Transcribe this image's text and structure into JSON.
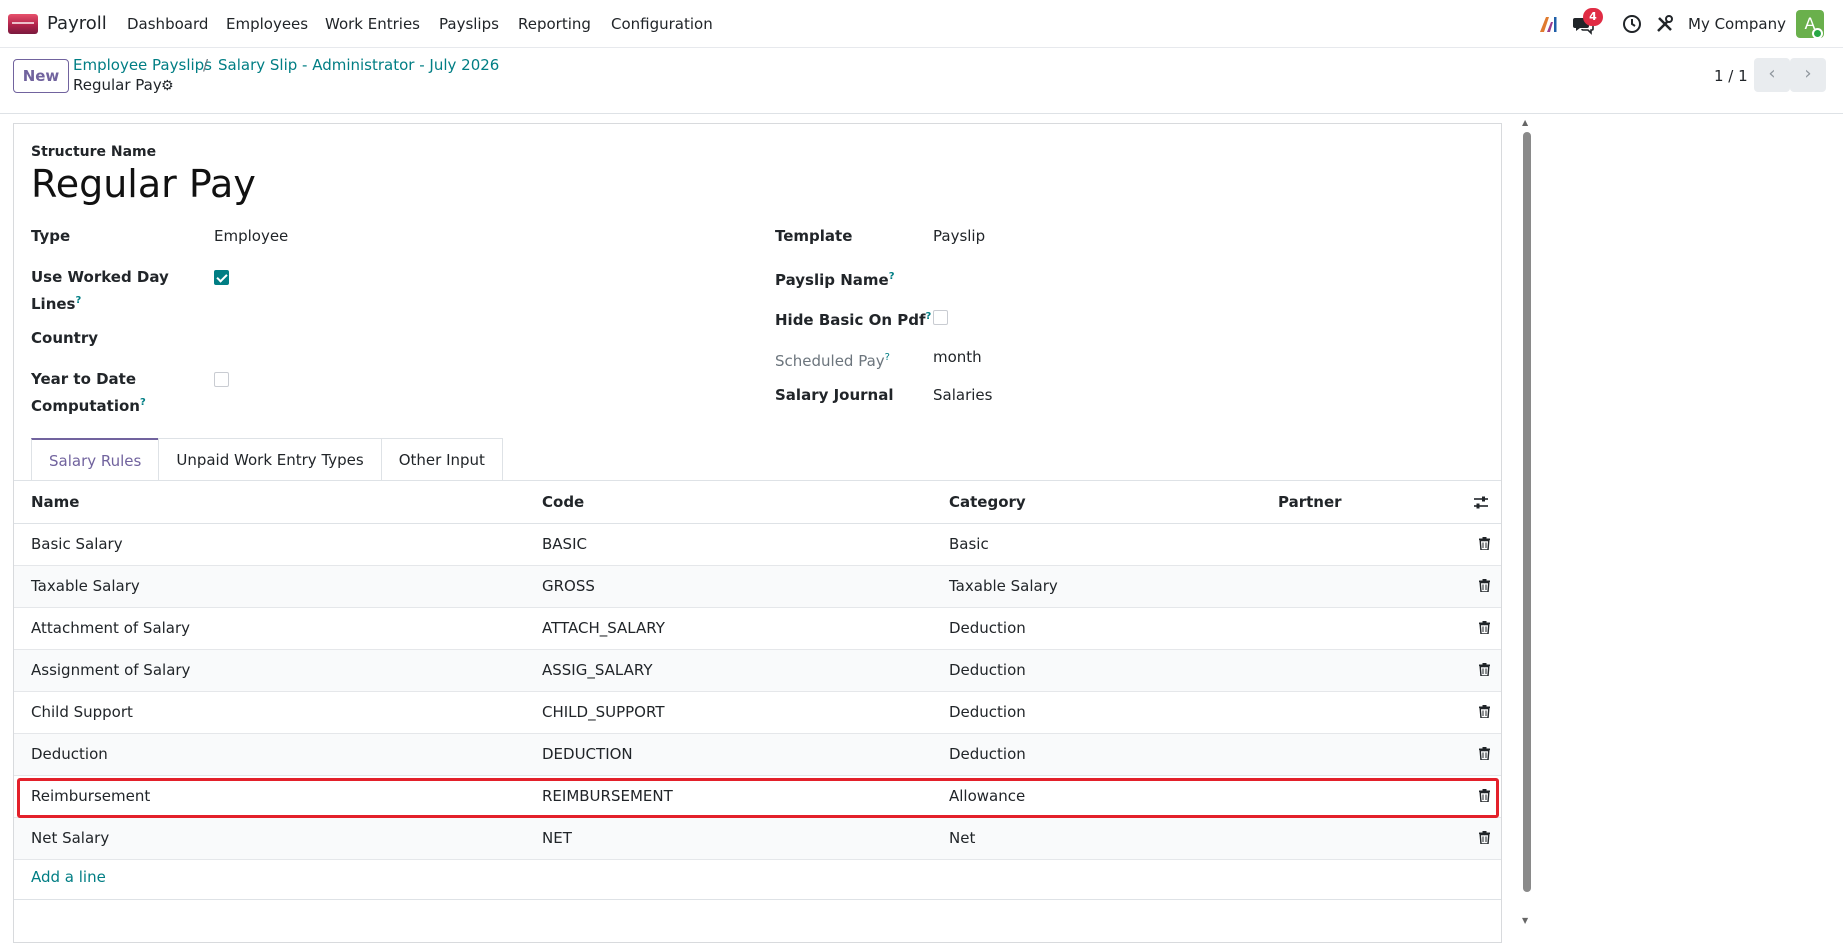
{
  "navbar": {
    "app_name": "Payroll",
    "menu": [
      "Dashboard",
      "Employees",
      "Work Entries",
      "Payslips",
      "Reporting",
      "Configuration"
    ],
    "messages_count": "4",
    "company": "My Company",
    "avatar_letter": "A"
  },
  "control": {
    "new_label": "New",
    "breadcrumbs": [
      "Employee Payslips",
      "Salary Slip - Administrator - July 2026"
    ],
    "separator": "/",
    "record_title": "Regular Pay",
    "pager": "1 / 1"
  },
  "form": {
    "structure_name_label": "Structure Name",
    "structure_name": "Regular Pay",
    "type_label": "Type",
    "type_value": "Employee",
    "worked_day_label_1": "Use Worked Day",
    "worked_day_label_2": "Lines",
    "worked_day_checked": true,
    "country_label": "Country",
    "ytd_label_1": "Year to Date",
    "ytd_label_2": "Computation",
    "ytd_checked": false,
    "template_label": "Template",
    "template_value": "Payslip",
    "payslip_name_label": "Payslip Name",
    "hide_basic_label": "Hide Basic On Pdf",
    "hide_basic_checked": false,
    "scheduled_pay_label": "Scheduled Pay",
    "scheduled_pay_value": "month",
    "salary_journal_label": "Salary Journal",
    "salary_journal_value": "Salaries",
    "help_mark": "?"
  },
  "tabs": [
    "Salary Rules",
    "Unpaid Work Entry Types",
    "Other Input"
  ],
  "table": {
    "headers": [
      "Name",
      "Code",
      "Category",
      "Partner"
    ],
    "rows": [
      {
        "name": "Basic Salary",
        "code": "BASIC",
        "category": "Basic"
      },
      {
        "name": "Taxable Salary",
        "code": "GROSS",
        "category": "Taxable Salary"
      },
      {
        "name": "Attachment of Salary",
        "code": "ATTACH_SALARY",
        "category": "Deduction"
      },
      {
        "name": "Assignment of Salary",
        "code": "ASSIG_SALARY",
        "category": "Deduction"
      },
      {
        "name": "Child Support",
        "code": "CHILD_SUPPORT",
        "category": "Deduction"
      },
      {
        "name": "Deduction",
        "code": "DEDUCTION",
        "category": "Deduction"
      },
      {
        "name": "Reimbursement",
        "code": "REIMBURSEMENT",
        "category": "Allowance"
      },
      {
        "name": "Net Salary",
        "code": "NET",
        "category": "Net"
      }
    ],
    "add_line": "Add a line"
  },
  "colors": {
    "accent": "#71639e",
    "link": "#017e84",
    "highlight": "#e3202a"
  }
}
